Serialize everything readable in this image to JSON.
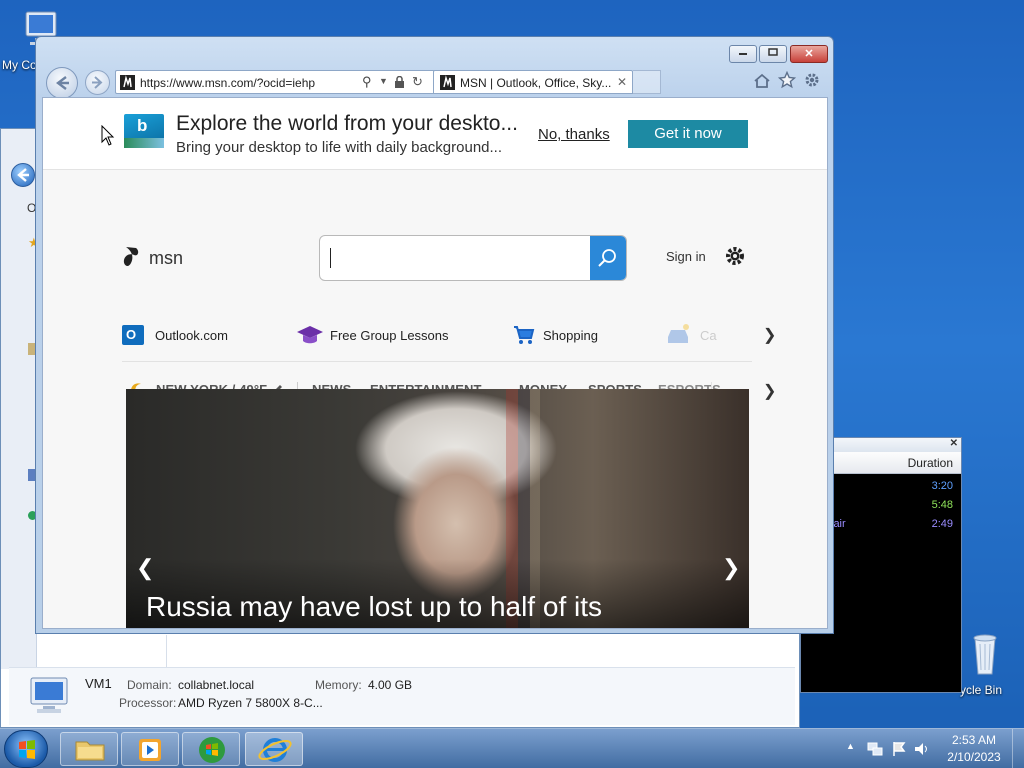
{
  "desktop": {
    "icon_computer_label": "My Co",
    "icon_recycle_label": "ycle Bin"
  },
  "explorer": {
    "tab_text": "O",
    "computer_name": "VM1",
    "domain_label": "Domain:",
    "domain_value": "collabnet.local",
    "memory_label": "Memory:",
    "memory_value": "4.00 GB",
    "processor_label": "Processor:",
    "processor_value": "AMD Ryzen 7 5800X 8-C..."
  },
  "media_player": {
    "column_header": "Duration",
    "partial_title": "lair",
    "rows": [
      {
        "duration": "3:20",
        "color": "#5ea0ff"
      },
      {
        "duration": "5:48",
        "color": "#8fe35a"
      },
      {
        "duration": "2:49",
        "color": "#9a8cff"
      }
    ],
    "close_glyph": "✕"
  },
  "ie": {
    "address": "https://www.msn.com/?ocid=iehp",
    "tab_title": "MSN | Outlook, Office, Sky...",
    "tab_close": "✕",
    "banner": {
      "title": "Explore the world from your deskto...",
      "subtitle": "Bring your desktop to life with daily background...",
      "no_thanks": "No, thanks",
      "get_it_now": "Get it now"
    },
    "msn": {
      "logo_text": "msn",
      "search_value": "",
      "sign_in": "Sign in"
    },
    "shortcuts": [
      {
        "label": "Outlook.com",
        "icon": "outlook-icon"
      },
      {
        "label": "Free Group Lessons",
        "icon": "graduation-cap-icon"
      },
      {
        "label": "Shopping",
        "icon": "shopping-cart-icon"
      },
      {
        "label": "Ca",
        "icon": "car-icon"
      }
    ],
    "weather": "NEW YORK / 49°F",
    "categories": [
      "NEWS",
      "ENTERTAINMENT",
      "MONEY",
      "SPORTS",
      "ESPORTS"
    ],
    "headline": "Russia may have lost up to half of its"
  },
  "clock": {
    "time": "2:53 AM",
    "date": "2/10/2023"
  },
  "colors": {
    "msn_blue": "#2b88d8",
    "get_it_now_bg": "#1d8aa3",
    "win_close": "#c8413a"
  }
}
